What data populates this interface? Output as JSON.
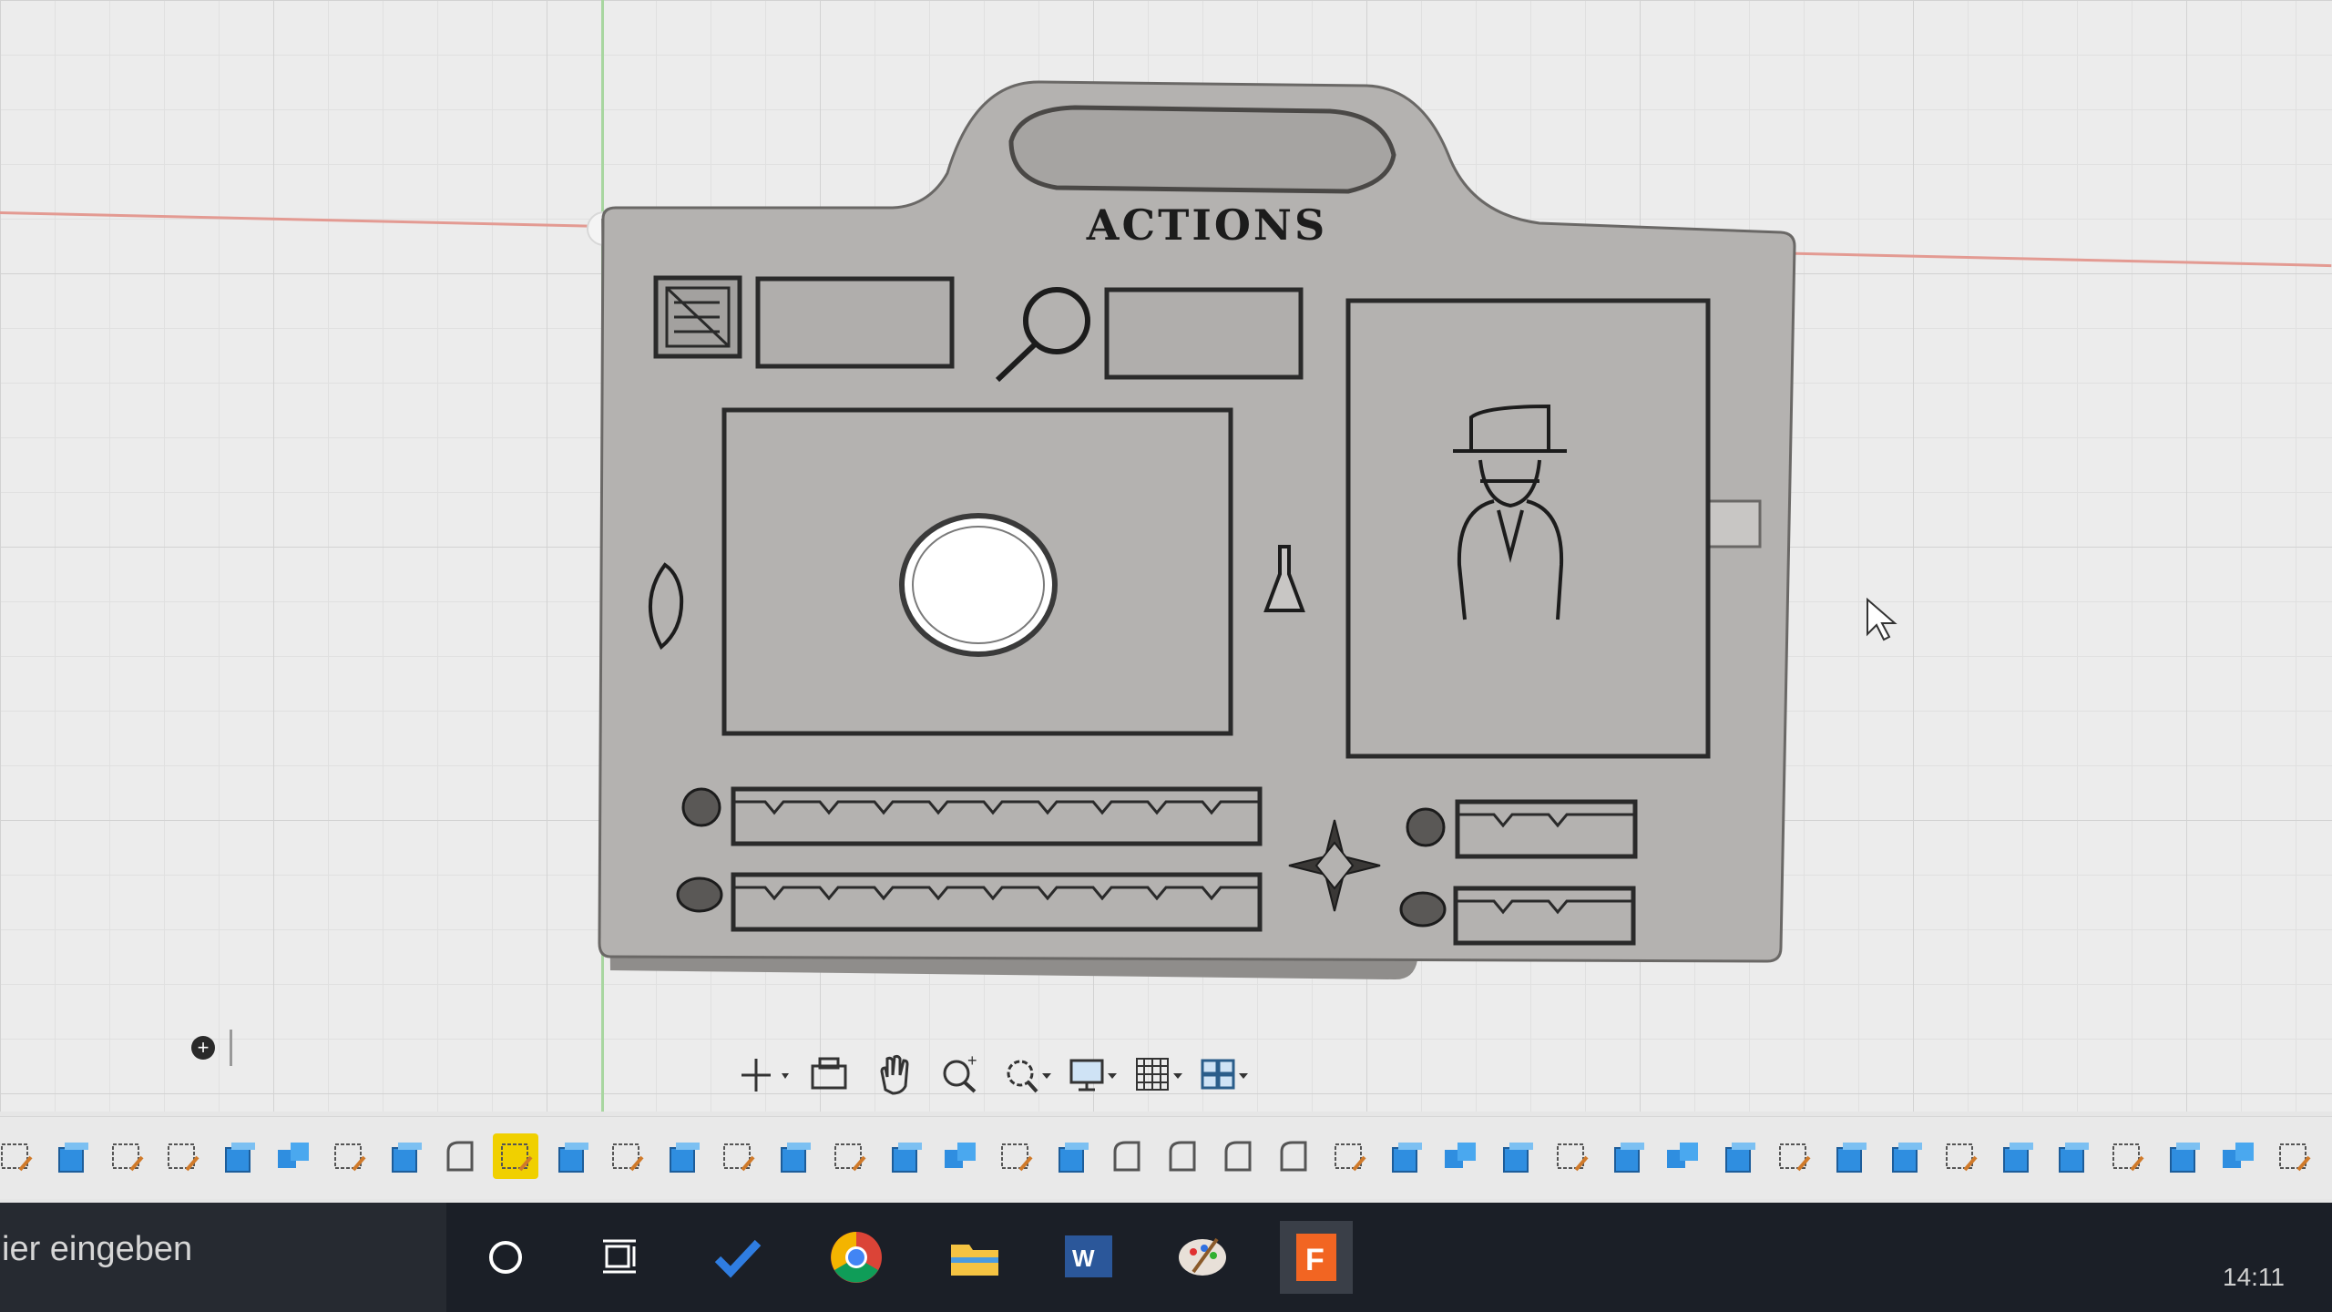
{
  "canvas": {
    "board_title": "ACTIONS"
  },
  "view_toolbar": {
    "items": [
      "orbit-icon",
      "look-at-icon",
      "pan-icon",
      "zoom-icon",
      "fit-icon",
      "display-settings-icon",
      "grid-icon",
      "viewports-icon"
    ]
  },
  "timeline": {
    "items": [
      "sketch",
      "extrude",
      "sketch",
      "sketch",
      "extrude",
      "combine",
      "sketch",
      "extrude",
      "fillet",
      "sketch",
      "extrude",
      "sketch",
      "extrude",
      "sketch",
      "extrude",
      "sketch",
      "extrude",
      "combine",
      "sketch",
      "extrude",
      "fillet",
      "fillet",
      "fillet",
      "fillet",
      "sketch",
      "extrude",
      "combine",
      "extrude",
      "sketch",
      "extrude",
      "combine",
      "extrude",
      "sketch",
      "extrude",
      "extrude",
      "sketch",
      "extrude",
      "extrude",
      "sketch",
      "extrude",
      "combine",
      "sketch"
    ],
    "selected_index": 9
  },
  "taskbar": {
    "search_placeholder": "ier eingeben",
    "apps": [
      "cortana-icon",
      "task-view-icon",
      "todo-icon",
      "chrome-icon",
      "file-explorer-icon",
      "word-icon",
      "paint-icon",
      "fusion-icon"
    ],
    "clock": "14:11"
  },
  "colors": {
    "grid_background": "#ececec",
    "model_gray": "#b2b0ae",
    "axis_red": "#e39a92",
    "axis_green": "#a8d6a0",
    "selection_yellow": "#f0d000",
    "taskbar": "#1b1f27"
  }
}
